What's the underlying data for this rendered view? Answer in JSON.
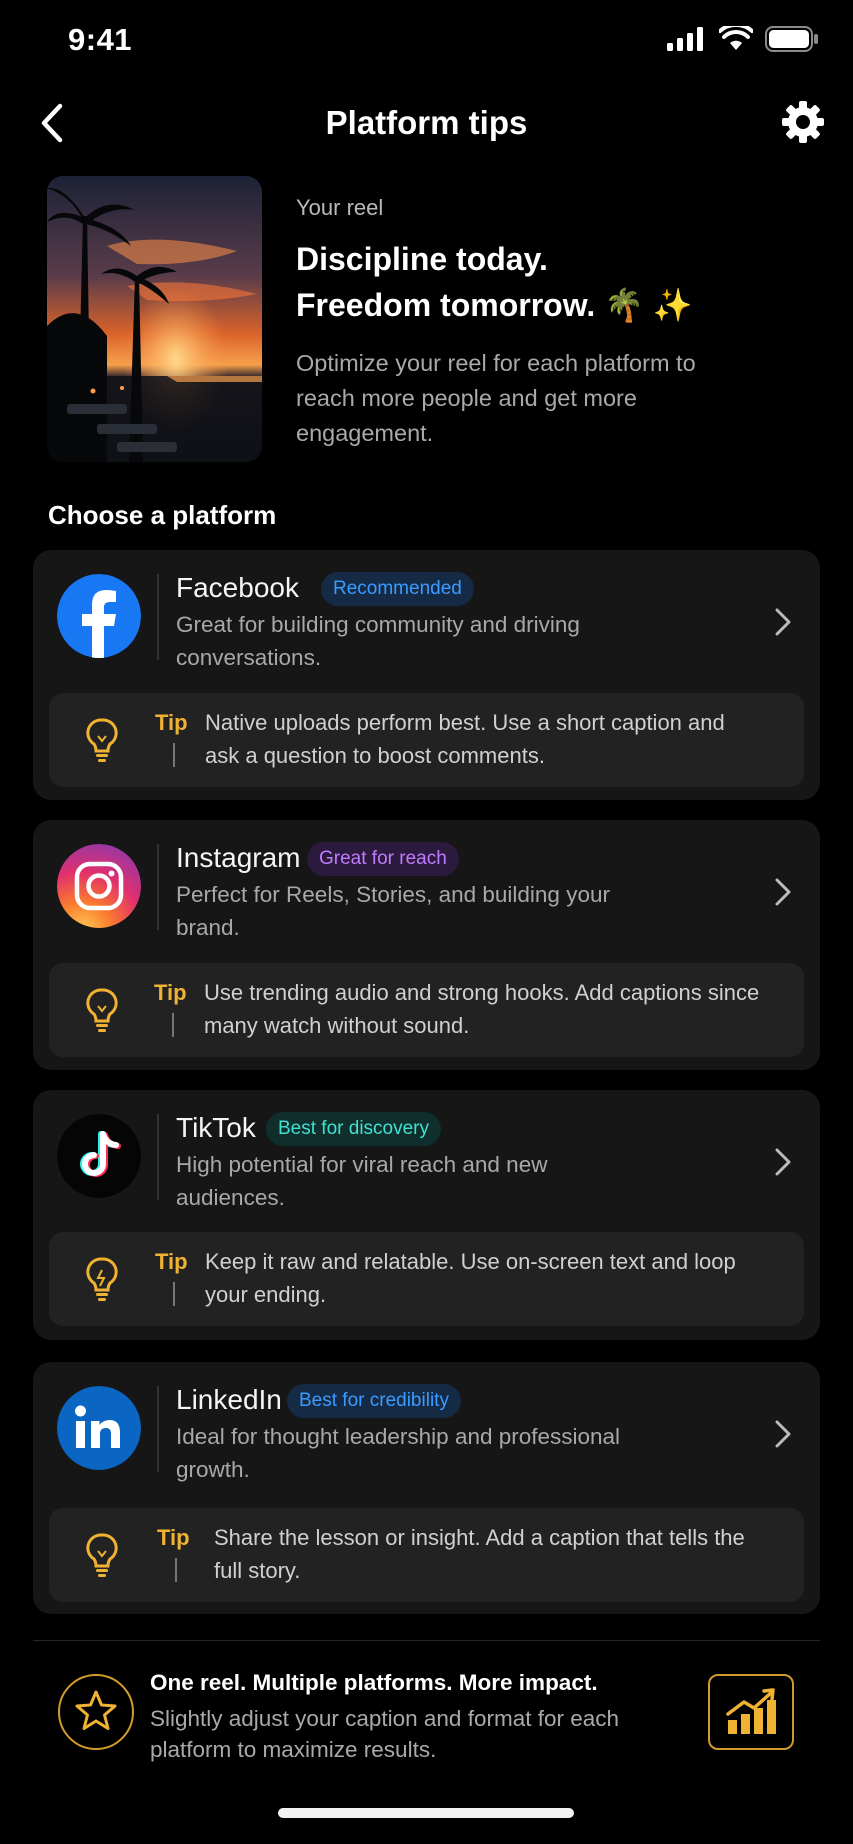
{
  "status": {
    "time": "9:41"
  },
  "nav": {
    "title": "Platform tips"
  },
  "reel": {
    "kicker": "Your reel",
    "title_line1": "Discipline today.",
    "title_line2": "Freedom tomorrow. 🌴 ✨",
    "description": "Optimize your reel for each platform to reach more people and get more engagement."
  },
  "section_label": "Choose a platform",
  "platforms": [
    {
      "name": "Facebook",
      "badge": "Recommended",
      "badge_color": "#3b9bff",
      "description": "Great for building community and driving conversations.",
      "tip_label": "Tip",
      "tip": "Native uploads perform best. Use a short caption and ask a question to boost comments."
    },
    {
      "name": "Instagram",
      "badge": "Great for reach",
      "badge_color": "#c07bff",
      "description": "Perfect for Reels, Stories, and building your brand.",
      "tip_label": "Tip",
      "tip": "Use trending audio and strong hooks. Add captions since many watch without sound."
    },
    {
      "name": "TikTok",
      "badge": "Best for discovery",
      "badge_color": "#41e0d0",
      "description": "High potential for viral reach and new audiences.",
      "tip_label": "Tip",
      "tip": "Keep it raw and relatable. Use on-screen text and loop your ending."
    },
    {
      "name": "LinkedIn",
      "badge": "Best for credibility",
      "badge_color": "#3b9bff",
      "description": "Ideal for thought leadership and professional growth.",
      "tip_label": "Tip",
      "tip": "Share the lesson or insight. Add a caption that tells the full story."
    }
  ],
  "footer": {
    "title": "One reel. Multiple platforms. More impact.",
    "description": "Slightly adjust your caption and format for each platform to maximize results."
  },
  "colors": {
    "accent": "#f0b232",
    "card": "#161616",
    "tip_bg": "#222222"
  }
}
